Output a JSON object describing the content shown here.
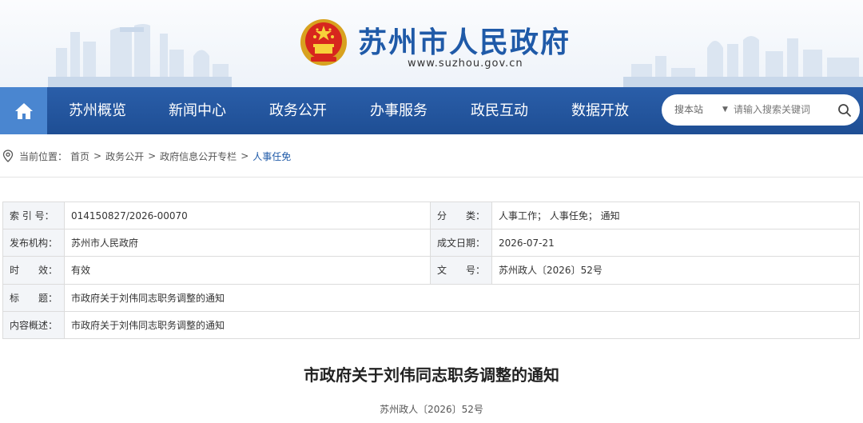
{
  "header": {
    "title": "苏州市人民政府",
    "url": "www.suzhou.gov.cn",
    "colors": {
      "brand_blue": "#1f5aa8",
      "nav_blue": "#2a5ea9",
      "home_blue": "#4a86d0"
    }
  },
  "nav": {
    "home_icon": "home-icon",
    "items": [
      {
        "label": "苏州概览"
      },
      {
        "label": "新闻中心"
      },
      {
        "label": "政务公开"
      },
      {
        "label": "办事服务"
      },
      {
        "label": "政民互动"
      },
      {
        "label": "数据开放"
      }
    ],
    "search": {
      "scope": "搜本站",
      "placeholder": "请输入搜索关键词",
      "icon": "search-icon"
    }
  },
  "breadcrumb": {
    "prefix": "当前位置：",
    "items": [
      "首页",
      "政务公开",
      "政府信息公开专栏"
    ],
    "current": "人事任免",
    "separator": ">"
  },
  "info": {
    "index_label": "索 引 号：",
    "index_value": "014150827/2026-00070",
    "category_label": "分　　类：",
    "category_value": "人事工作；  人事任免；  通知",
    "publisher_label": "发布机构：",
    "publisher_value": "苏州市人民政府",
    "date_label": "成文日期：",
    "date_value": "2026-07-21",
    "validity_label": "时　　效：",
    "validity_value": "有效",
    "docno_label": "文　　号：",
    "docno_value": "苏州政人〔2026〕52号",
    "title_label": "标　　题：",
    "title_value": "市政府关于刘伟同志职务调整的通知",
    "summary_label": "内容概述：",
    "summary_value": "市政府关于刘伟同志职务调整的通知"
  },
  "document": {
    "title": "市政府关于刘伟同志职务调整的通知",
    "number": "苏州政人〔2026〕52号"
  }
}
